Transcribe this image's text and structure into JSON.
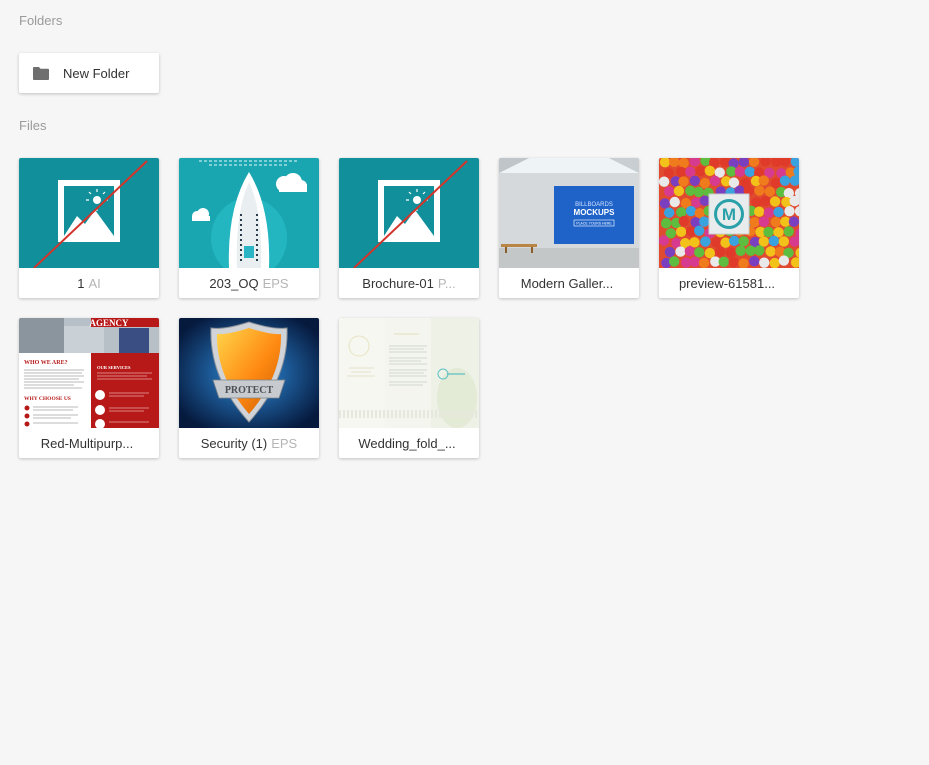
{
  "sections": {
    "folders_label": "Folders",
    "files_label": "Files"
  },
  "folders": [
    {
      "name": "New Folder",
      "icon": "folder-icon"
    }
  ],
  "files": [
    {
      "name": "1",
      "ext": "AI",
      "thumb": "broken-image",
      "bg": "#118f9b"
    },
    {
      "name": "203_OQ",
      "ext": "EPS",
      "thumb": "ship",
      "bg": "#1aa6b1"
    },
    {
      "name": "Brochure-01",
      "ext": "P...",
      "thumb": "broken-image",
      "bg": "#118f9b"
    },
    {
      "name": "Modern Galler...",
      "ext": "",
      "thumb": "gallery",
      "bg": "#d6d9db"
    },
    {
      "name": "preview-61581...",
      "ext": "",
      "thumb": "candy",
      "bg": "#e04a2f"
    },
    {
      "name": "Red-Multipurp...",
      "ext": "",
      "thumb": "agency",
      "bg": "#b71919"
    },
    {
      "name": "Security (1)",
      "ext": "EPS",
      "thumb": "shield",
      "bg": "#0d3b7a"
    },
    {
      "name": "Wedding_fold_...",
      "ext": "",
      "thumb": "wedding",
      "bg": "#f3f5ee"
    }
  ],
  "thumb_text": {
    "gallery_line1": "BILLBOARDS",
    "gallery_line2": "MOCKUPS",
    "gallery_line3": "PLACE YOURS HERE",
    "candy_logo": "M",
    "agency_title": "AGENCY",
    "agency_who": "WHO WE ARE?",
    "agency_why": "WHY CHOOSE US",
    "agency_services": "OUR SERVICES",
    "shield_label": "PROTECT"
  },
  "colors": {
    "background": "#f6f6f6",
    "card": "#ffffff",
    "label": "#9a9a9a",
    "text": "#333333",
    "ext": "#b5b5b5"
  }
}
